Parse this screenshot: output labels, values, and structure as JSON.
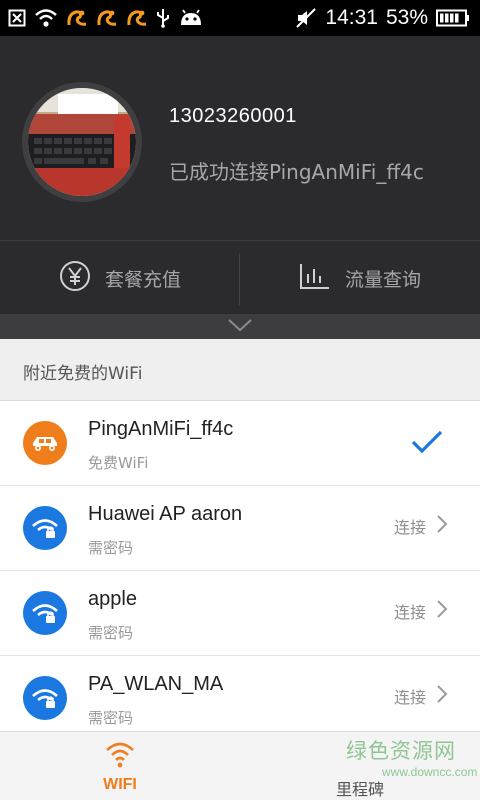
{
  "status_bar": {
    "time": "14:31",
    "battery_percent": "53%",
    "icons_left": [
      "close-box-icon",
      "wifi-icon",
      "squirrel-app-icon",
      "squirrel-app-icon",
      "squirrel-app-icon",
      "usb-icon",
      "android-icon"
    ],
    "icons_right": [
      "mute-icon",
      "battery-icon"
    ]
  },
  "profile": {
    "phone": "13023260001",
    "status": "已成功连接PingAnMiFi_ff4c"
  },
  "actions": {
    "recharge_label": "套餐充值",
    "recharge_icon": "yen-circle-icon",
    "traffic_label": "流量查询",
    "traffic_icon": "bar-chart-icon"
  },
  "section": {
    "title": "附近免费的WiFi"
  },
  "wifi_list": [
    {
      "name": "PingAnMiFi_ff4c",
      "sub": "免费WiFi",
      "icon": "car-icon",
      "icon_color": "#f07d1b",
      "state": "connected"
    },
    {
      "name": "Huawei AP aaron",
      "sub": "需密码",
      "icon": "wifi-lock-icon",
      "icon_color": "#1a78e0",
      "action": "连接"
    },
    {
      "name": "apple",
      "sub": "需密码",
      "icon": "wifi-lock-icon",
      "icon_color": "#1a78e0",
      "action": "连接"
    },
    {
      "name": "PA_WLAN_MA",
      "sub": "需密码",
      "icon": "wifi-lock-icon",
      "icon_color": "#1a78e0",
      "action": "连接"
    }
  ],
  "bottom_nav": {
    "tab_wifi": "WIFI",
    "tab_milestone": "里程碑"
  },
  "watermark": {
    "text": "绿色资源网",
    "url": "www.downcc.com"
  },
  "colors": {
    "accent": "#f07d1b",
    "check": "#1a78e0",
    "header_bg": "#2b2b2d"
  }
}
